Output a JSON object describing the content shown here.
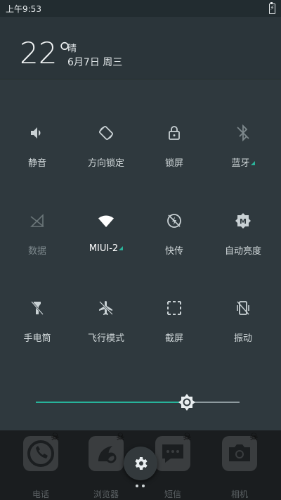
{
  "status_bar": {
    "time": "上午9:53"
  },
  "weather": {
    "temperature": "22°",
    "condition": "晴",
    "date": "6月7日 周三"
  },
  "quick_settings": {
    "row1": [
      {
        "label": "静音",
        "icon": "volume-icon"
      },
      {
        "label": "方向锁定",
        "icon": "rotation-lock-icon"
      },
      {
        "label": "锁屏",
        "icon": "lock-icon"
      },
      {
        "label": "蓝牙",
        "icon": "bluetooth-icon"
      }
    ],
    "row2": [
      {
        "label": "数据",
        "icon": "mobile-data-off-icon"
      },
      {
        "label": "MIUI-2",
        "icon": "wifi-icon"
      },
      {
        "label": "快传",
        "icon": "quick-transfer-icon"
      },
      {
        "label": "自动亮度",
        "icon": "auto-brightness-icon"
      }
    ],
    "row3": [
      {
        "label": "手电筒",
        "icon": "flashlight-icon"
      },
      {
        "label": "飞行模式",
        "icon": "airplane-icon"
      },
      {
        "label": "截屏",
        "icon": "screenshot-icon"
      },
      {
        "label": "振动",
        "icon": "vibrate-icon"
      }
    ]
  },
  "brightness": {
    "level": 0.74,
    "accent": "#27b39a"
  },
  "dock": {
    "apps": [
      {
        "label": "电话"
      },
      {
        "label": "浏览器"
      },
      {
        "label": "短信"
      },
      {
        "label": "相机"
      }
    ]
  }
}
